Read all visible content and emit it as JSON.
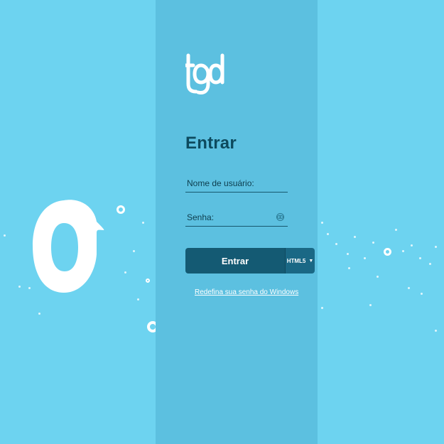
{
  "branding": {
    "logo_text": "tgd",
    "brand_color": "#6dd3f0",
    "panel_color": "#5cc0e0",
    "accent_color": "#145a73"
  },
  "login": {
    "title": "Entrar",
    "username_placeholder": "Nome de usuário:",
    "password_placeholder": "Senha:",
    "password_toggle_icon": "eye-icon",
    "submit_label": "Entrar",
    "mode_selector": {
      "label": "HTML5",
      "icon": "chevron-down-icon"
    },
    "reset_link": "Redefina sua senha do Windows"
  }
}
